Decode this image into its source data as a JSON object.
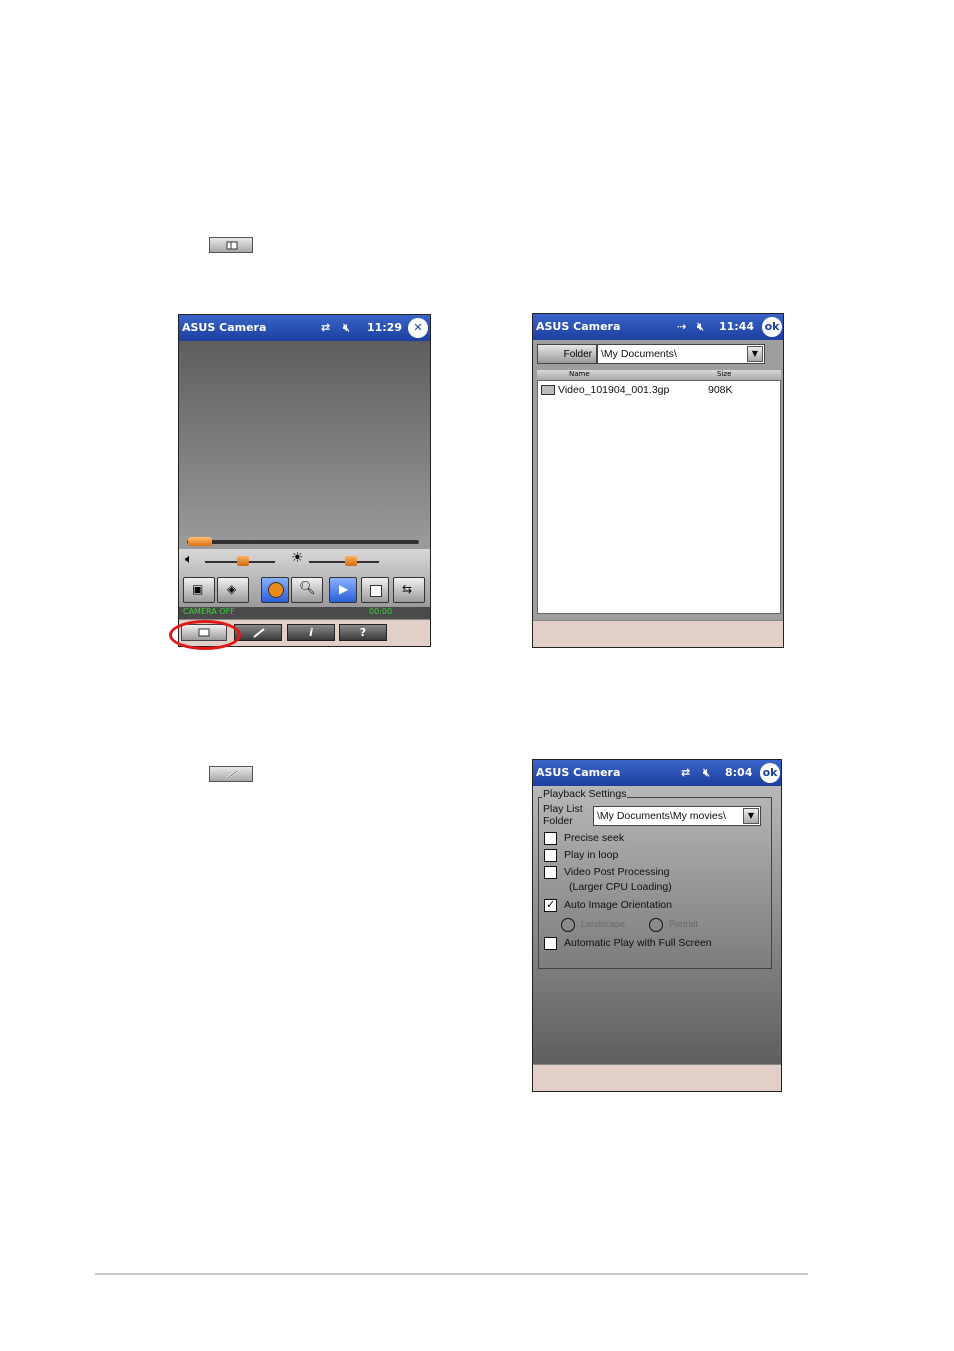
{
  "screen1": {
    "title": "ASUS Camera",
    "time": "11:29",
    "status_left": "CAMERA OFF",
    "status_right": "00:00",
    "tabs": [
      "list",
      "settings",
      "i",
      "?"
    ]
  },
  "screen2": {
    "title": "ASUS Camera",
    "time": "11:44",
    "ok_label": "ok",
    "folder_label": "Folder",
    "folder_value": "\\My Documents\\",
    "col_name": "Name",
    "col_size": "Size",
    "files": [
      {
        "name": "Video_101904_001.3gp",
        "size": "908K"
      }
    ]
  },
  "screen3": {
    "title": "ASUS Camera",
    "time": "8:04",
    "ok_label": "ok",
    "group_label": "Playback Settings",
    "playlist_label_1": "Play List",
    "playlist_label_2": "Folder",
    "playlist_value": "\\My Documents\\My movies\\",
    "options": [
      {
        "label": "Precise seek",
        "checked": false
      },
      {
        "label": "Play in loop",
        "checked": false
      },
      {
        "label": "Video Post Processing",
        "checked": false
      },
      {
        "label": "Auto Image Orientation",
        "checked": true
      },
      {
        "label": "Automatic Play with Full Screen",
        "checked": false
      }
    ],
    "post_processing_note": "(Larger CPU Loading)",
    "radio_1": "Landscape",
    "radio_2": "Portrait"
  }
}
